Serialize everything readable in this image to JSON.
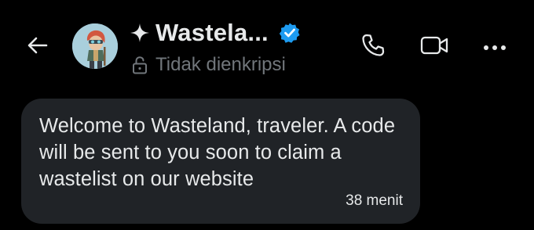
{
  "header": {
    "back_icon": "arrow-left-icon",
    "name": "Wastela...",
    "name_prefix_icon": "sparkle-icon",
    "verified_icon": "verified-badge-icon",
    "encryption_status": "Tidak dienkripsi",
    "encryption_icon": "lock-open-icon",
    "actions": [
      {
        "icon": "phone-icon"
      },
      {
        "icon": "video-camera-icon"
      },
      {
        "icon": "more-horizontal-icon"
      }
    ]
  },
  "messages": [
    {
      "text": "Welcome to Wasteland, traveler. A code will be sent to you soon to claim a wastelist on our website",
      "time": "38 menit"
    }
  ],
  "colors": {
    "background": "#000000",
    "bubble": "#202327",
    "text": "#e7e9ea",
    "muted": "#71767b",
    "verified": "#1d9bf0"
  }
}
